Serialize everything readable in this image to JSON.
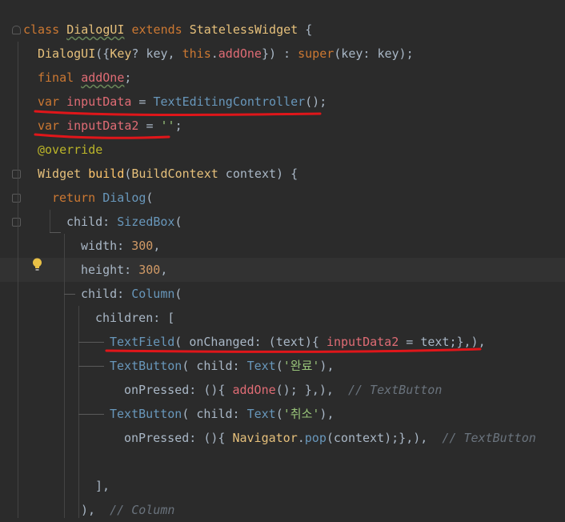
{
  "editor": {
    "lines": [
      {
        "id": "l1",
        "parts": [
          [
            "kw",
            "class "
          ],
          [
            "cls wavy",
            "DialogUI"
          ],
          [
            "kw",
            " extends "
          ],
          [
            "cls",
            "StatelessWidget"
          ],
          [
            "plain",
            " {"
          ]
        ]
      },
      {
        "id": "l2",
        "parts": [
          [
            "cls",
            "DialogUI"
          ],
          [
            "plain",
            "({"
          ],
          [
            "cls",
            "Key"
          ],
          [
            "plain",
            "? key, "
          ],
          [
            "kw",
            "this"
          ],
          [
            "plain",
            "."
          ],
          [
            "field",
            "addOne"
          ],
          [
            "plain",
            "}) : "
          ],
          [
            "kw",
            "super"
          ],
          [
            "plain",
            "(key: key);"
          ]
        ]
      },
      {
        "id": "l3",
        "parts": [
          [
            "kw",
            "final "
          ],
          [
            "field wavy",
            "addOne"
          ],
          [
            "plain",
            ";"
          ]
        ]
      },
      {
        "id": "l4",
        "parts": [
          [
            "kw",
            "var "
          ],
          [
            "field",
            "inputData"
          ],
          [
            "plain",
            " = "
          ],
          [
            "typ",
            "TextEditingController"
          ],
          [
            "plain",
            "();"
          ]
        ]
      },
      {
        "id": "l5",
        "parts": [
          [
            "kw",
            "var "
          ],
          [
            "field",
            "inputData2"
          ],
          [
            "plain",
            " = "
          ],
          [
            "str",
            "''"
          ],
          [
            "plain",
            ";"
          ]
        ]
      },
      {
        "id": "l6",
        "parts": [
          [
            "ann",
            "@override"
          ]
        ]
      },
      {
        "id": "l7",
        "parts": [
          [
            "cls",
            "Widget "
          ],
          [
            "fn",
            "build"
          ],
          [
            "plain",
            "("
          ],
          [
            "cls",
            "BuildContext"
          ],
          [
            "plain",
            " context) {"
          ]
        ]
      },
      {
        "id": "l8",
        "parts": [
          [
            "kw",
            "return "
          ],
          [
            "typ",
            "Dialog"
          ],
          [
            "plain",
            "("
          ]
        ]
      },
      {
        "id": "l9",
        "parts": [
          [
            "plain",
            "child: "
          ],
          [
            "typ",
            "SizedBox"
          ],
          [
            "plain",
            "("
          ]
        ]
      },
      {
        "id": "l10",
        "parts": [
          [
            "plain",
            "width: "
          ],
          [
            "num",
            "300"
          ],
          [
            "plain",
            ","
          ]
        ]
      },
      {
        "id": "l11",
        "parts": [
          [
            "plain",
            "height: "
          ],
          [
            "num",
            "300"
          ],
          [
            "plain",
            ","
          ]
        ]
      },
      {
        "id": "l12",
        "parts": [
          [
            "plain",
            "child: "
          ],
          [
            "typ",
            "Column"
          ],
          [
            "plain",
            "("
          ]
        ]
      },
      {
        "id": "l13",
        "parts": [
          [
            "plain",
            "children: ["
          ]
        ]
      },
      {
        "id": "l14",
        "parts": [
          [
            "typ",
            "TextField"
          ],
          [
            "plain",
            "( onChanged: (text){ "
          ],
          [
            "field",
            "inputData2"
          ],
          [
            "plain",
            " = text;},),"
          ]
        ]
      },
      {
        "id": "l15",
        "parts": [
          [
            "typ",
            "TextButton"
          ],
          [
            "plain",
            "( child: "
          ],
          [
            "typ",
            "Text"
          ],
          [
            "plain",
            "("
          ],
          [
            "str",
            "'완료'"
          ],
          [
            "plain",
            "),"
          ]
        ]
      },
      {
        "id": "l16",
        "parts": [
          [
            "plain",
            "onPressed: (){ "
          ],
          [
            "field",
            "addOne"
          ],
          [
            "plain",
            "(); },),  "
          ],
          [
            "cmt",
            "// TextButton"
          ]
        ]
      },
      {
        "id": "l17",
        "parts": [
          [
            "typ",
            "TextButton"
          ],
          [
            "plain",
            "( child: "
          ],
          [
            "typ",
            "Text"
          ],
          [
            "plain",
            "("
          ],
          [
            "str",
            "'취소'"
          ],
          [
            "plain",
            "),"
          ]
        ]
      },
      {
        "id": "l18",
        "parts": [
          [
            "plain",
            "onPressed: (){ "
          ],
          [
            "cls",
            "Navigator"
          ],
          [
            "plain",
            "."
          ],
          [
            "typ",
            "pop"
          ],
          [
            "plain",
            "(context);},),  "
          ],
          [
            "cmt",
            "// TextButton"
          ]
        ]
      },
      {
        "id": "l19",
        "parts": []
      },
      {
        "id": "l20",
        "parts": [
          [
            "plain",
            "],"
          ]
        ]
      },
      {
        "id": "l21",
        "parts": [
          [
            "plain",
            "),  "
          ],
          [
            "cmt",
            "// Column"
          ]
        ]
      }
    ]
  },
  "colors": {
    "background": "#2b2b2b",
    "current_line": "#323232",
    "annotation_red": "#e0161a",
    "bulb": "#e8c046"
  },
  "icons": {
    "intention_bulb": "lightbulb-icon",
    "fold_marker": "fold-marker-icon"
  }
}
